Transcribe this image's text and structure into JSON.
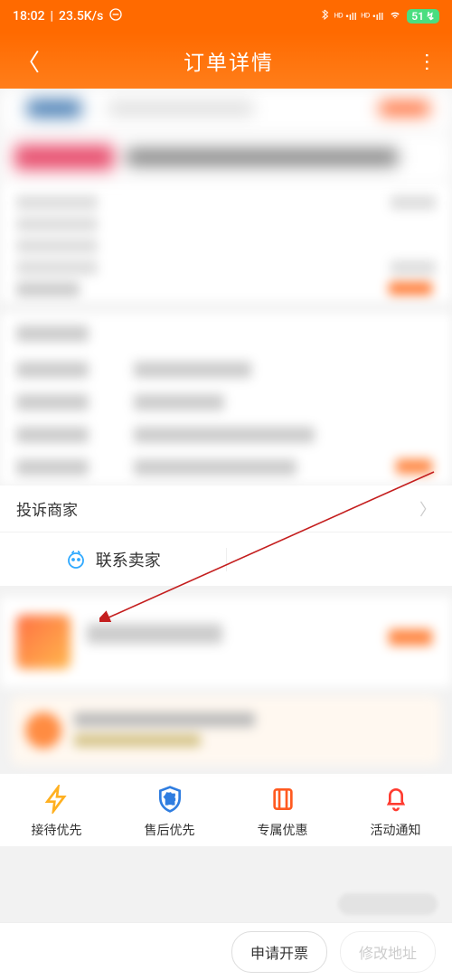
{
  "status": {
    "time": "18:02",
    "speed": "23.5K/s",
    "battery": "51"
  },
  "nav": {
    "title": "订单详情"
  },
  "complaint": {
    "label": "投诉商家"
  },
  "contact": {
    "seller_label": "联系卖家"
  },
  "services": [
    {
      "label": "接待优先",
      "color": "#ffb020"
    },
    {
      "label": "售后优先",
      "color": "#2f7de0"
    },
    {
      "label": "专属优惠",
      "color": "#ff5a20"
    },
    {
      "label": "活动通知",
      "color": "#ff3b30"
    }
  ],
  "bottom": {
    "invoice": "申请开票",
    "modify_address": "修改地址"
  }
}
